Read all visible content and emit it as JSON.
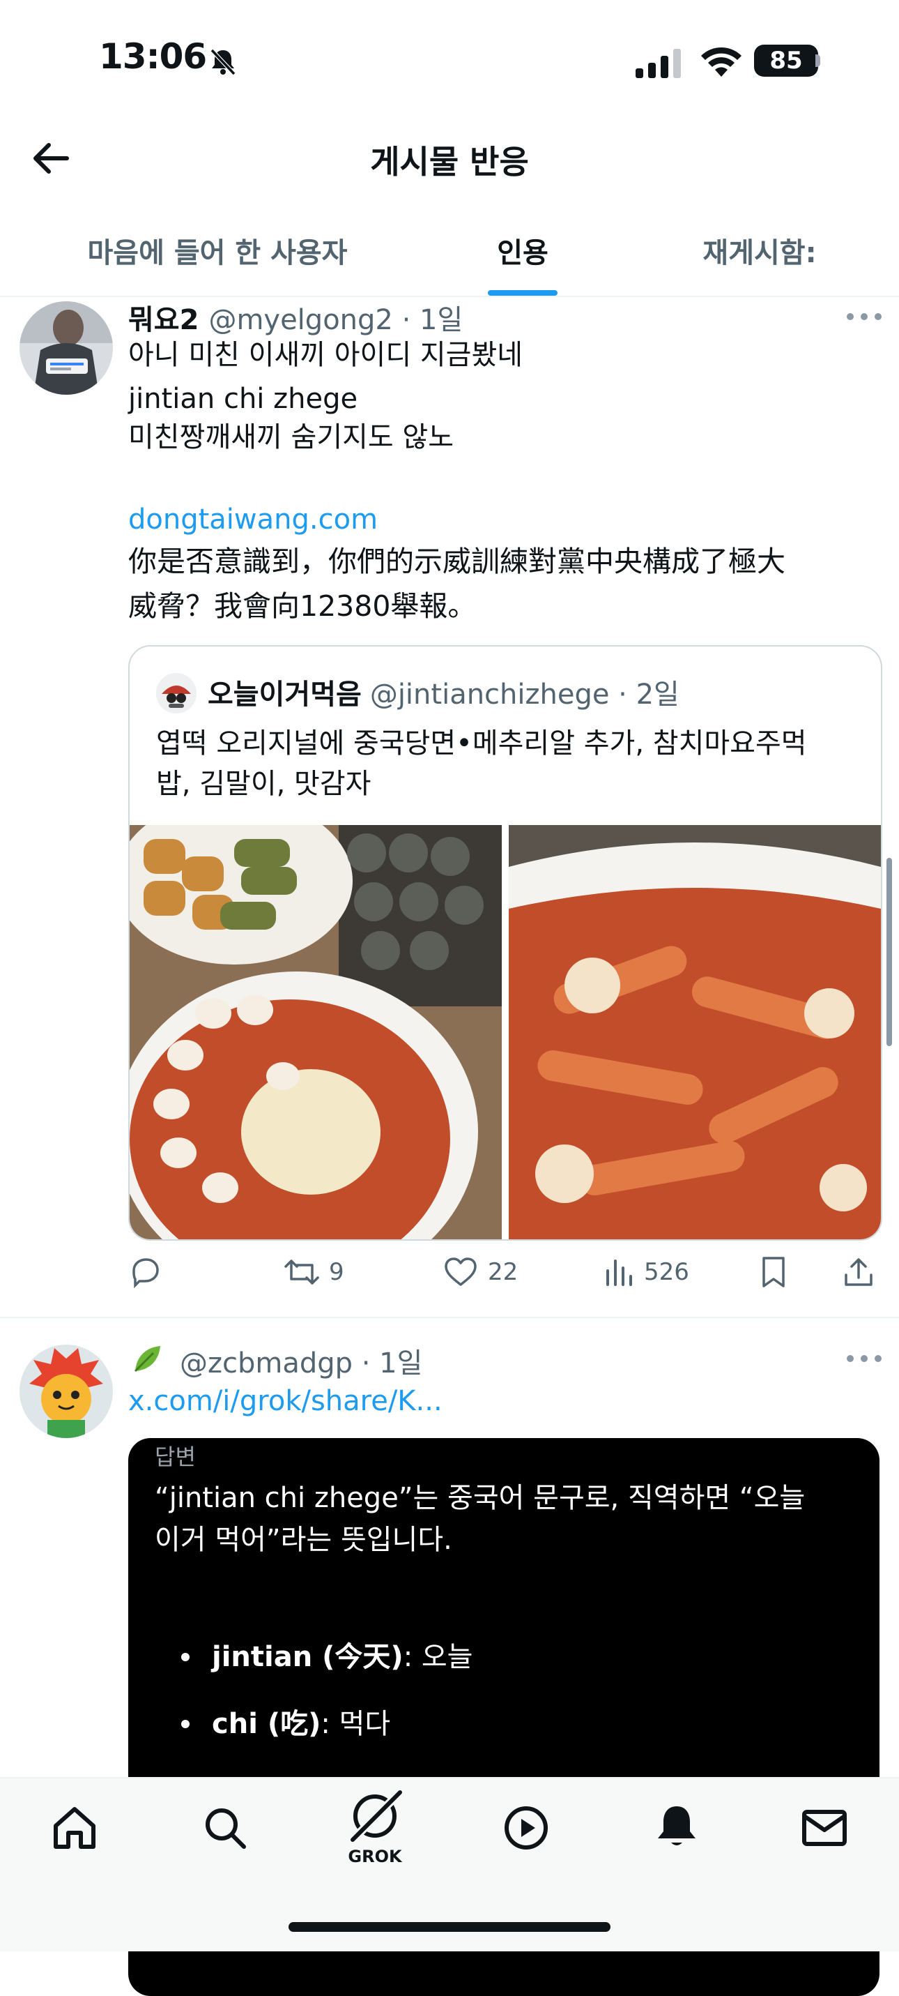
{
  "status_bar": {
    "time": "13:06",
    "battery": "85"
  },
  "header": {
    "title": "게시물 반응"
  },
  "tabs": [
    {
      "label": "마음에 들어 한 사용자",
      "active": false
    },
    {
      "label": "인용",
      "active": true
    },
    {
      "label": "재게시함:",
      "active": false
    }
  ],
  "post1": {
    "name": "뭐요2",
    "handle": "@myelgong2 · 1일",
    "lines": [
      "아니 미친 이새끼 아이디 지금봤네",
      "jintian chi zhege",
      "미친짱깨새끼 숨기지도 않노"
    ],
    "link": "dongtaiwang.com",
    "link_text_lines": [
      "你是否意識到，你們的示威訓練對黨中央構成了極大",
      "威脅？我會向12380舉報。"
    ],
    "quote": {
      "name": "오늘이거먹음",
      "handle": "@jintianchizhege · 2일",
      "text_lines": [
        "엽떡 오리지널에 중국당면•메추리알 추가, 참치마요주먹",
        "밥, 김말이, 맛감자"
      ]
    },
    "actions": {
      "reposts": "9",
      "likes": "22",
      "views": "526"
    }
  },
  "post2": {
    "handle": "@zcbmadgp · 1일",
    "link": "x.com/i/grok/share/K...",
    "grok": {
      "label": "답변",
      "text_lines": [
        "“jintian chi zhege”는 중국어 문구로, 직역하면 “오늘",
        "이거 먹어”라는 뜻입니다."
      ],
      "bullets": [
        {
          "term": "jintian (今天)",
          "meaning": ": 오늘"
        },
        {
          "term": "chi (吃)",
          "meaning": ": 먹다"
        }
      ]
    }
  },
  "bottom_nav": {
    "grok_label": "GROK"
  },
  "colors": {
    "accent": "#1d9bf0",
    "text": "#0f1419",
    "muted": "#536471"
  }
}
